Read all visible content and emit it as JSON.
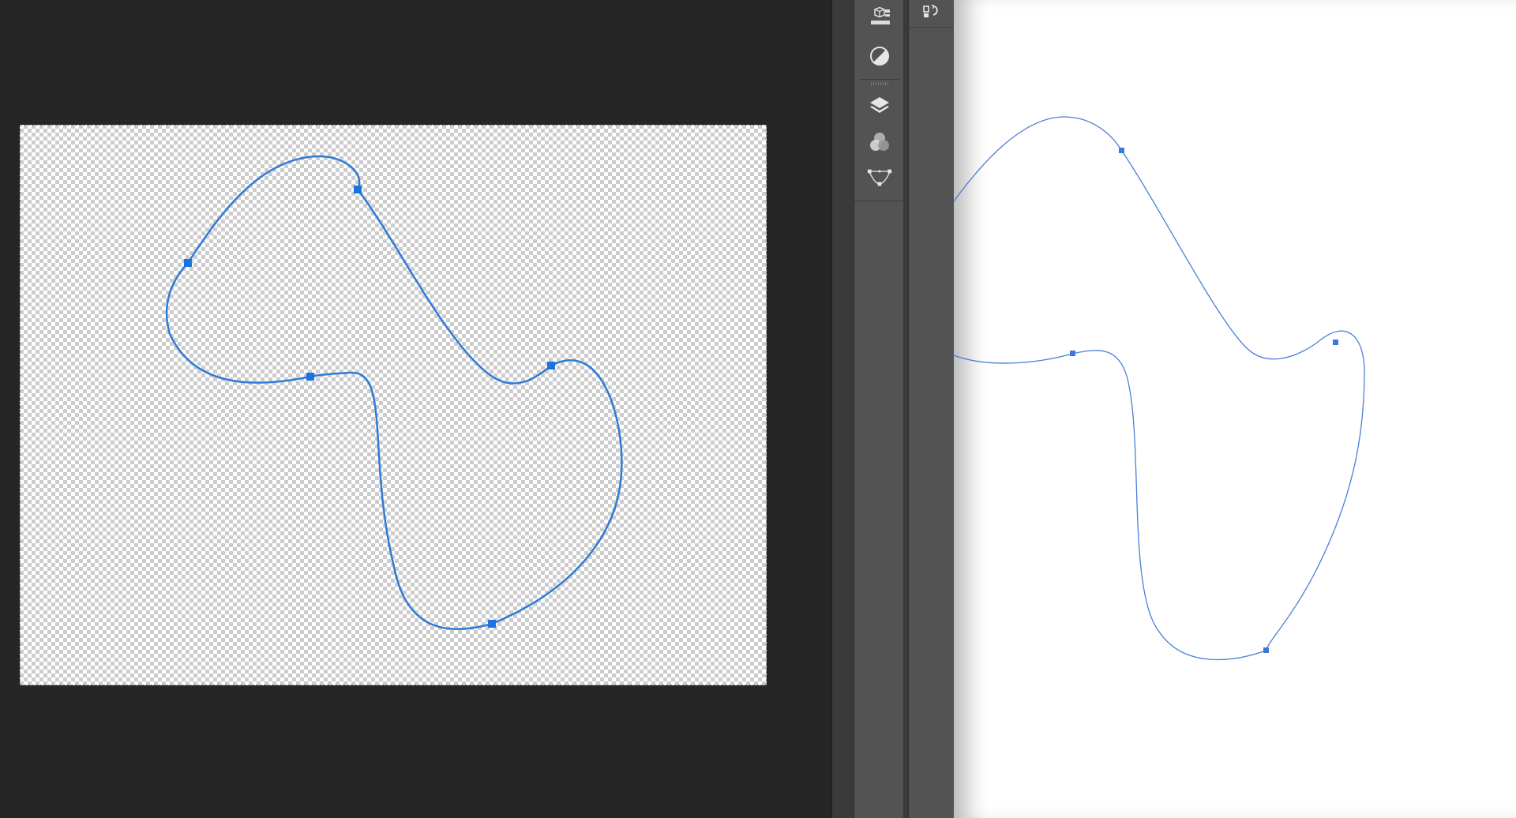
{
  "photoshop": {
    "workspace_color": "#262626",
    "canvas_background": "transparent-checkerboard",
    "path_color": "#2f7bd6",
    "anchor_color": "#1a74e0"
  },
  "panel_icons": [
    {
      "id": "libraries",
      "icon": "3d-cube-libraries-icon"
    },
    {
      "id": "adjustments",
      "icon": "half-circle-adjustments-icon"
    },
    {
      "id": "layers",
      "icon": "layers-stack-icon"
    },
    {
      "id": "channels",
      "icon": "channels-circles-icon"
    },
    {
      "id": "paths",
      "icon": "pen-path-icon"
    }
  ],
  "secondary_strip_icon": "history-brush-icon",
  "illustrator": {
    "artboard_color": "#ffffff",
    "path_color": "#4a7fd8",
    "anchor_color": "#3c78d8"
  }
}
